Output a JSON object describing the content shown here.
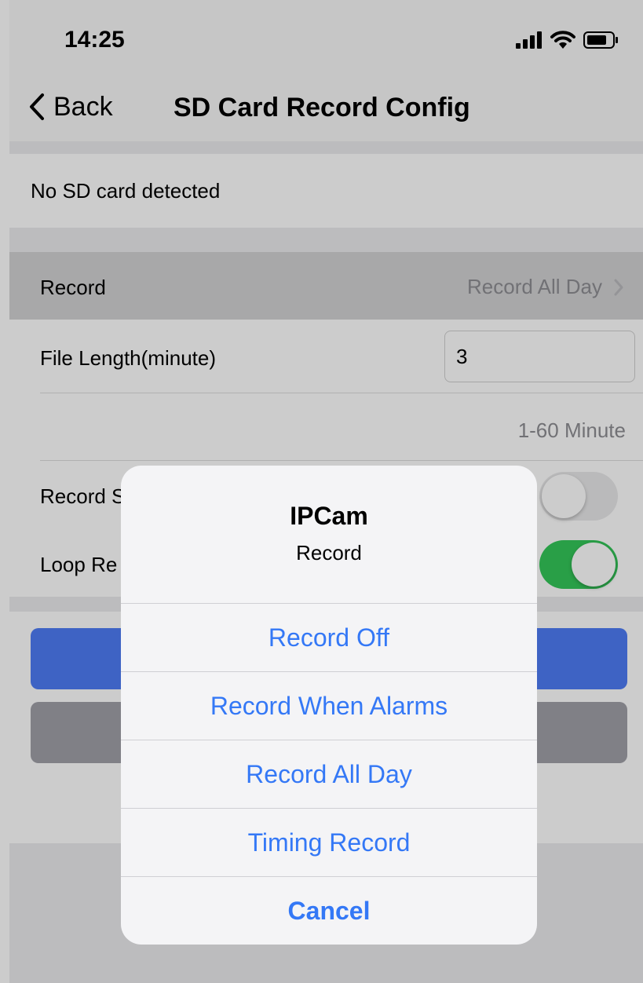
{
  "status_bar": {
    "time": "14:25"
  },
  "nav": {
    "back_label": "Back",
    "title": "SD Card Record Config"
  },
  "sd_status": "No SD card detected",
  "settings": {
    "record_label": "Record",
    "record_value": "Record All Day",
    "file_length_label": "File Length(minute)",
    "file_length_value": "3",
    "file_length_hint": "1-60 Minute",
    "record_sound_label": "Record S",
    "record_sound_on": false,
    "loop_record_label": "Loop Re",
    "loop_record_on": true
  },
  "colors": {
    "accent": "#3478f6",
    "switch_on": "#34c759",
    "primary_button": "#4e7cf6",
    "secondary_button": "#a0a0a8"
  },
  "alert": {
    "title": "IPCam",
    "message": "Record",
    "options": [
      "Record Off",
      "Record When Alarms",
      "Record All Day",
      "Timing Record"
    ],
    "cancel": "Cancel"
  }
}
